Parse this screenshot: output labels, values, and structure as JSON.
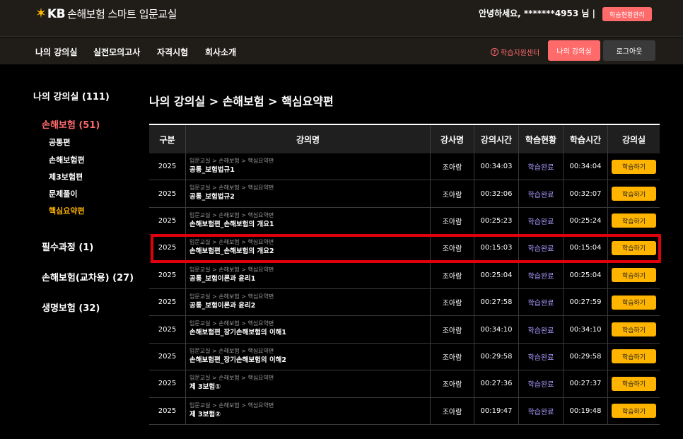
{
  "header": {
    "logo_star": "✶",
    "logo_kb": "KB",
    "logo_text": "손해보험 스마트 입문교실",
    "greeting": "안녕하세요, *******4953 님 |",
    "manage_button": "학습현황관리"
  },
  "nav": {
    "items": [
      "나의 강의실",
      "실전모의고사",
      "자격시험",
      "회사소개"
    ],
    "support_icon": "?",
    "support_label": "학습지원센터",
    "my_room_button": "나의 강의실",
    "logout_button": "로그아웃"
  },
  "sidebar": {
    "title": "나의 강의실 (111)",
    "categories": [
      {
        "label": "손해보험 (51)",
        "active": true
      },
      {
        "label": "필수과정 (1)",
        "active": false
      },
      {
        "label": "손해보험(교차용) (27)",
        "active": false
      },
      {
        "label": "생명보험 (32)",
        "active": false
      }
    ],
    "subitems": [
      {
        "label": "공통편",
        "active": false
      },
      {
        "label": "손해보험편",
        "active": false
      },
      {
        "label": "제3보험편",
        "active": false
      },
      {
        "label": "문제풀이",
        "active": false
      },
      {
        "label": "핵심요약편",
        "active": true
      }
    ]
  },
  "main": {
    "title": "나의 강의실 > 손해보험 > 핵심요약편",
    "table": {
      "headers": [
        "구분",
        "강의명",
        "강사명",
        "강의시간",
        "학습현황",
        "학습시간",
        "강의실"
      ],
      "rows": [
        {
          "year": "2025",
          "path": "입문교실 > 손해보험 > 핵심요약편",
          "name": "공통_보험법규1",
          "teacher": "조아람",
          "duration": "00:34:03",
          "status": "학습완료",
          "study_time": "00:34:04",
          "button": "학습하기"
        },
        {
          "year": "2025",
          "path": "입문교실 > 손해보험 > 핵심요약편",
          "name": "공통_보험법규2",
          "teacher": "조아람",
          "duration": "00:32:06",
          "status": "학습완료",
          "study_time": "00:32:07",
          "button": "학습하기"
        },
        {
          "year": "2025",
          "path": "입문교실 > 손해보험 > 핵심요약편",
          "name": "손해보험편_손해보험의 개요1",
          "teacher": "조아람",
          "duration": "00:25:23",
          "status": "학습완료",
          "study_time": "00:25:24",
          "button": "학습하기"
        },
        {
          "year": "2025",
          "path": "입문교실 > 손해보험 > 핵심요약편",
          "name": "손해보험편_손해보험의 개요2",
          "teacher": "조아람",
          "duration": "00:15:03",
          "status": "학습완료",
          "study_time": "00:15:04",
          "button": "학습하기"
        },
        {
          "year": "2025",
          "path": "입문교실 > 손해보험 > 핵심요약편",
          "name": "공통_보험이론과 윤리1",
          "teacher": "조아람",
          "duration": "00:25:04",
          "status": "학습완료",
          "study_time": "00:25:04",
          "button": "학습하기"
        },
        {
          "year": "2025",
          "path": "입문교실 > 손해보험 > 핵심요약편",
          "name": "공통_보험이론과 윤리2",
          "teacher": "조아람",
          "duration": "00:27:58",
          "status": "학습완료",
          "study_time": "00:27:59",
          "button": "학습하기"
        },
        {
          "year": "2025",
          "path": "입문교실 > 손해보험 > 핵심요약편",
          "name": "손해보험편_장기손해보험의 이해1",
          "teacher": "조아람",
          "duration": "00:34:10",
          "status": "학습완료",
          "study_time": "00:34:10",
          "button": "학습하기"
        },
        {
          "year": "2025",
          "path": "입문교실 > 손해보험 > 핵심요약편",
          "name": "손해보험편_장기손해보험의 이해2",
          "teacher": "조아람",
          "duration": "00:29:58",
          "status": "학습완료",
          "study_time": "00:29:58",
          "button": "학습하기"
        },
        {
          "year": "2025",
          "path": "입문교실 > 손해보험 > 핵심요약편",
          "name": "제 3보험①",
          "teacher": "조아람",
          "duration": "00:27:36",
          "status": "학습완료",
          "study_time": "00:27:37",
          "button": "학습하기"
        },
        {
          "year": "2025",
          "path": "입문교실 > 손해보험 > 핵심요약편",
          "name": "제 3보험②",
          "teacher": "조아람",
          "duration": "00:19:47",
          "status": "학습완료",
          "study_time": "00:19:48",
          "button": "학습하기"
        }
      ],
      "highlighted_row": 4
    }
  },
  "colors": {
    "accent_red": "#ff6a6a",
    "accent_yellow": "#ffb400",
    "status_purple": "#a99bff",
    "highlight_border": "#e0000c"
  }
}
